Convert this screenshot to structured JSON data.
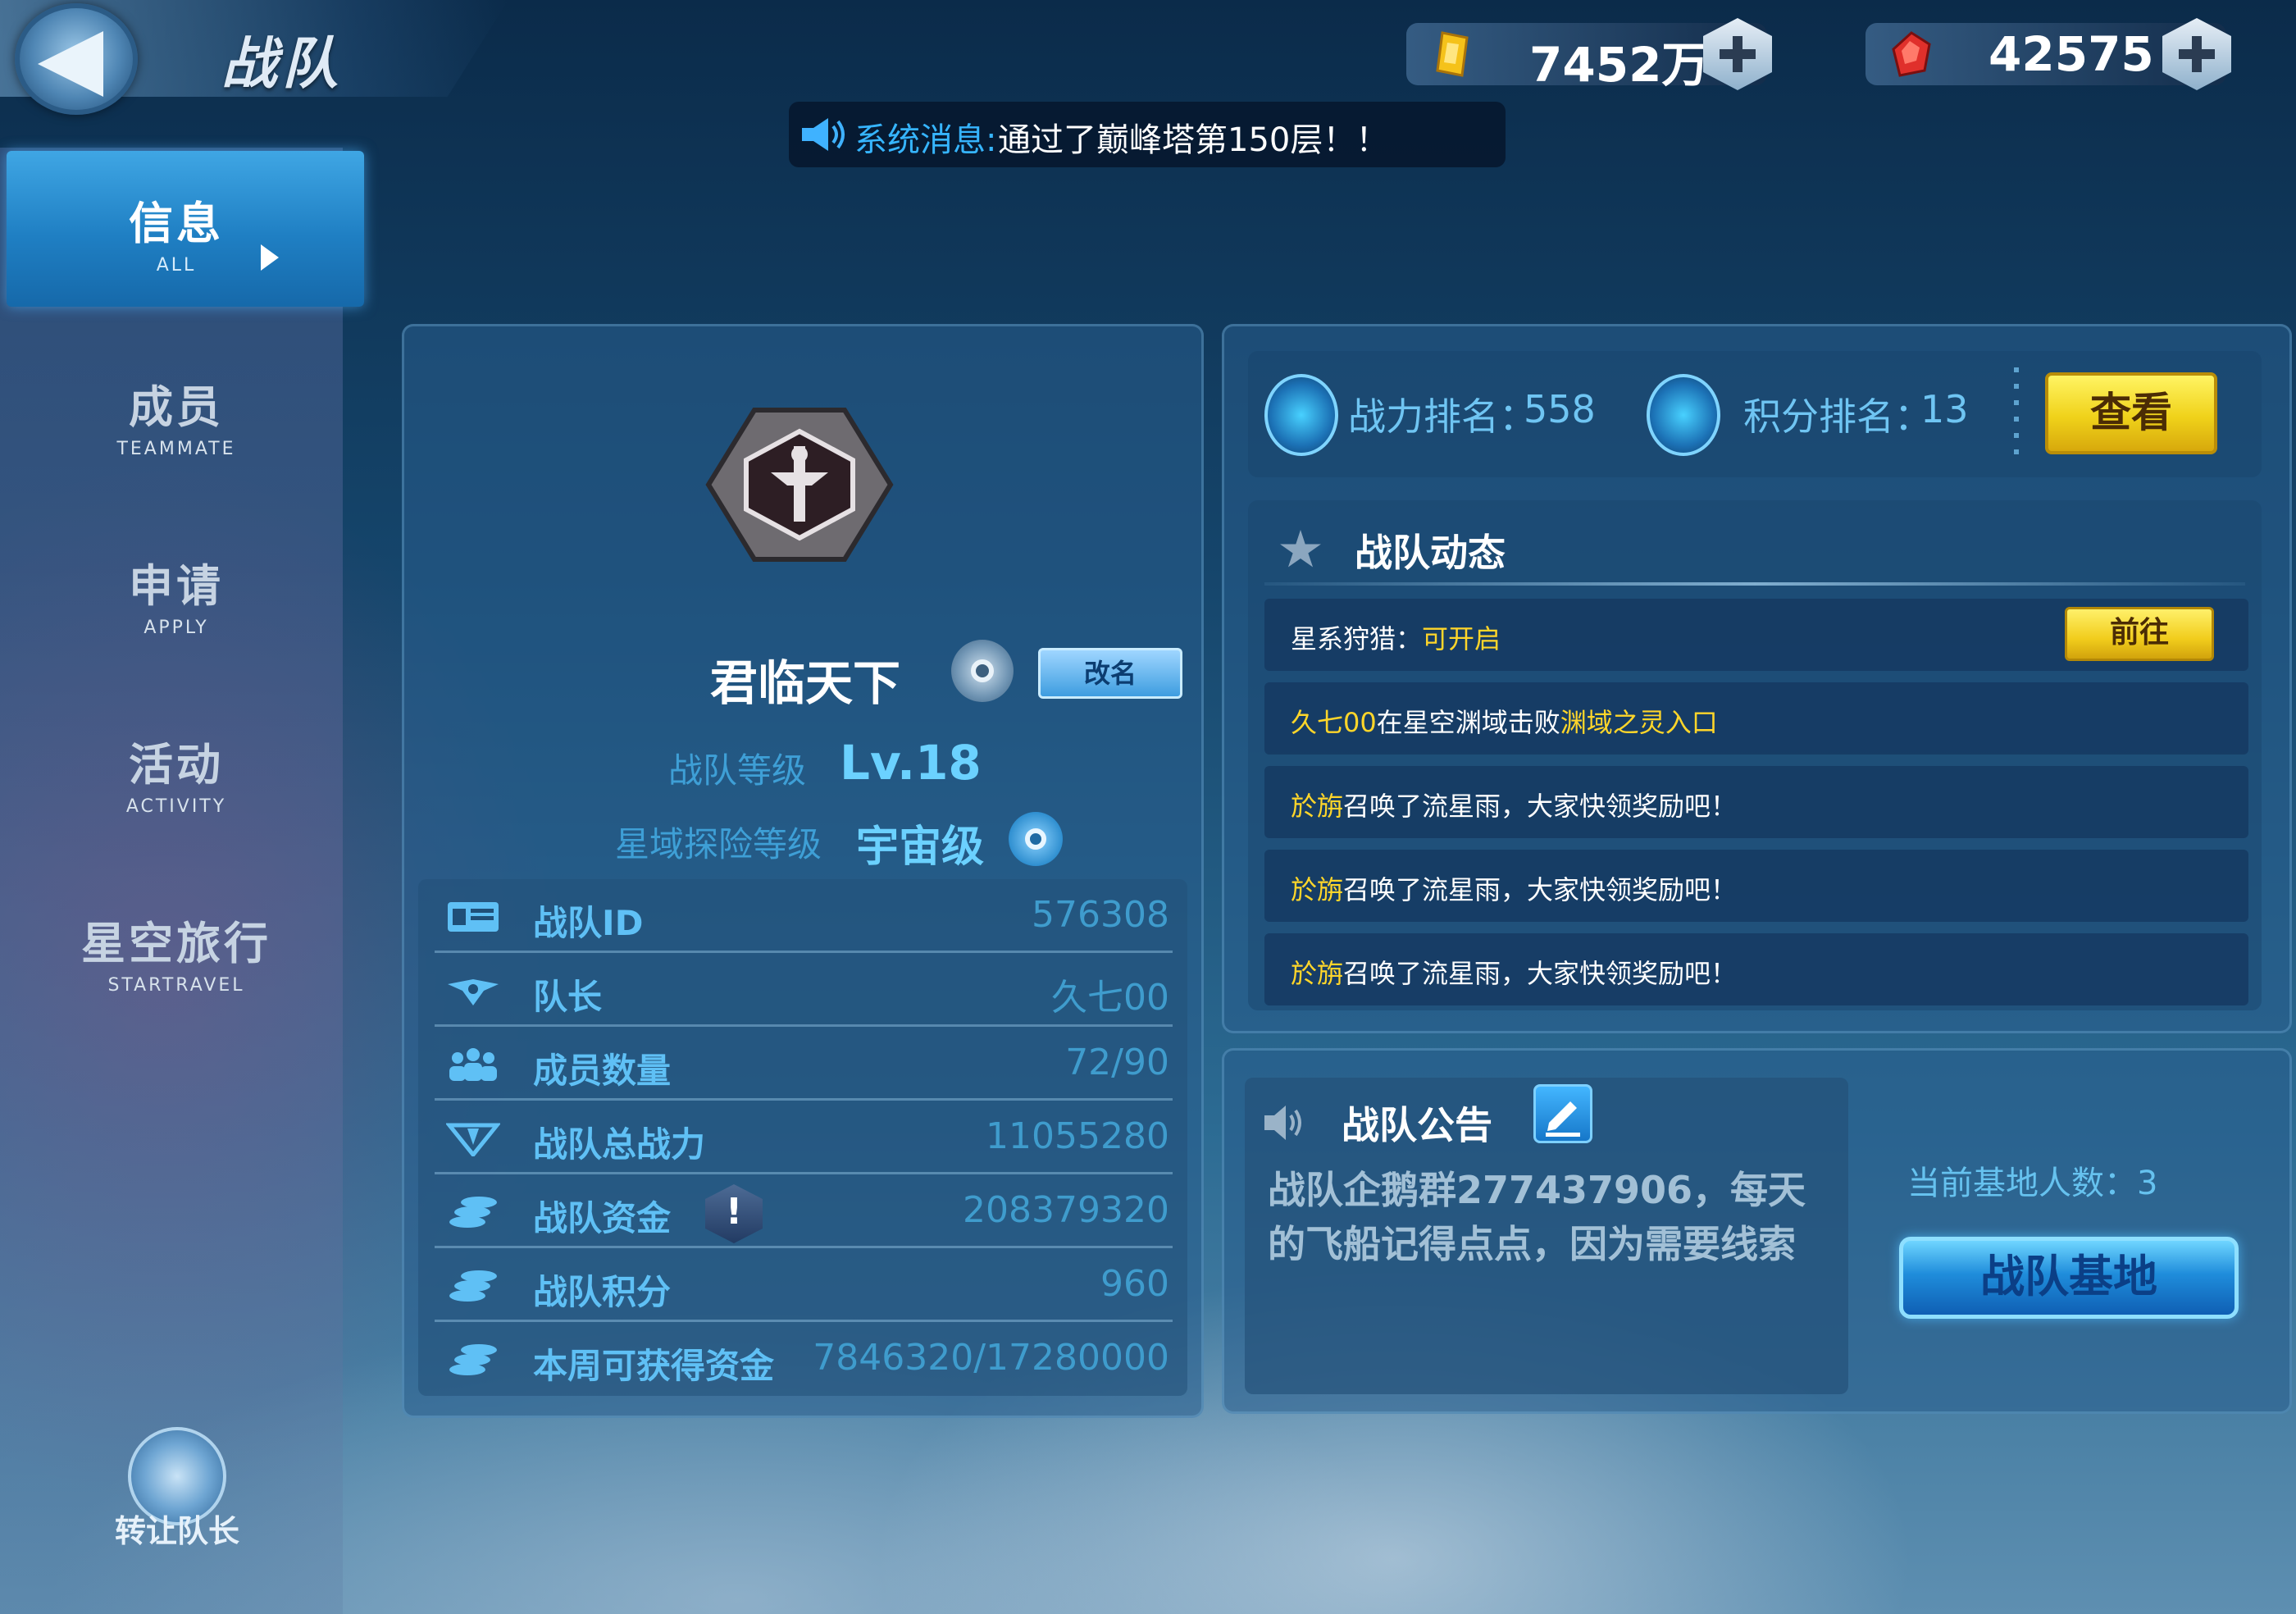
{
  "header": {
    "title": "战队"
  },
  "currency": {
    "gold": {
      "value": "7452万",
      "icon": "gold-coin-icon"
    },
    "gem": {
      "value": "42575",
      "icon": "red-gem-icon"
    }
  },
  "system_message": {
    "label": "系统消息:",
    "text": "通过了巅峰塔第150层！！"
  },
  "sidebar": {
    "items": [
      {
        "cn": "信息",
        "en": "ALL"
      },
      {
        "cn": "成员",
        "en": "TEAMMATE"
      },
      {
        "cn": "申请",
        "en": "APPLY"
      },
      {
        "cn": "活动",
        "en": "ACTIVITY"
      },
      {
        "cn": "星空旅行",
        "en": "STARTRAVEL"
      }
    ],
    "transfer_label": "转让队长"
  },
  "team": {
    "name": "君临天下",
    "rename_label": "改名",
    "level_label": "战队等级",
    "level_value": "Lv.18",
    "explore_label": "星域探险等级",
    "explore_value": "宇宙级"
  },
  "stats": [
    {
      "label": "战队ID",
      "value": "576308",
      "icon": "id-card-icon"
    },
    {
      "label": "队长",
      "value": "久七00",
      "icon": "captain-wings-icon"
    },
    {
      "label": "成员数量",
      "value": "72/90",
      "icon": "members-icon"
    },
    {
      "label": "战队总战力",
      "value": "11055280",
      "icon": "power-icon"
    },
    {
      "label": "战队资金",
      "value": "208379320",
      "icon": "coins-stack-icon"
    },
    {
      "label": "战队积分",
      "value": "960",
      "icon": "coins-stack-icon"
    },
    {
      "label": "本周可获得资金",
      "value": "7846320/17280000",
      "icon": "coins-stack-icon"
    }
  ],
  "rank": {
    "power_label": "战力排名：",
    "power_value": "558",
    "score_label": "积分排名：",
    "score_value": "13",
    "view_label": "查看"
  },
  "dynamics": {
    "title": "战队动态",
    "hunt": {
      "label": "星系狩猎：",
      "status": "可开启",
      "go_label": "前往"
    },
    "rows": [
      {
        "p1": "久七00",
        "p2": "在星空渊域击败",
        "p3": "渊域之灵入口"
      },
      {
        "p1": "於旃",
        "p2": "召唤了流星雨，大家快领奖励吧！"
      },
      {
        "p1": "於旃",
        "p2": "召唤了流星雨，大家快领奖励吧！"
      },
      {
        "p1": "於旃",
        "p2": "召唤了流星雨，大家快领奖励吧！"
      }
    ]
  },
  "notice": {
    "title": "战队公告",
    "text": "战队企鹅群277437906，每天的飞船记得点点，因为需要线索"
  },
  "base": {
    "count_label": "当前基地人数：",
    "count_value": "3",
    "button_label": "战队基地"
  }
}
